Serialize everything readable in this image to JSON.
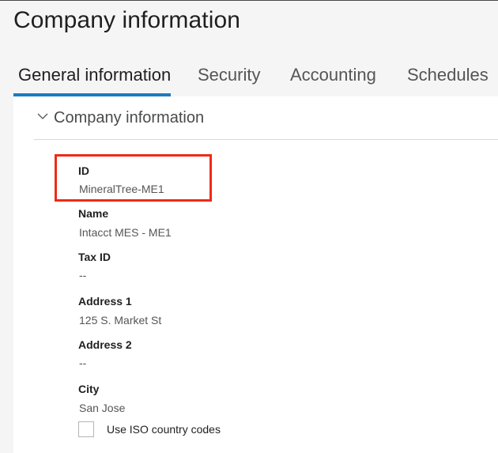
{
  "page": {
    "title": "Company information"
  },
  "tabs": [
    {
      "label": "General information",
      "active": true
    },
    {
      "label": "Security",
      "active": false
    },
    {
      "label": "Accounting",
      "active": false
    },
    {
      "label": "Schedules",
      "active": false
    }
  ],
  "section": {
    "title": "Company information",
    "expanded": true,
    "icon": "chevron-down-icon"
  },
  "fields": {
    "id": {
      "label": "ID",
      "value": "MineralTree-ME1"
    },
    "name": {
      "label": "Name",
      "value": "Intacct MES - ME1"
    },
    "tax_id": {
      "label": "Tax ID",
      "value": "--"
    },
    "address1": {
      "label": "Address 1",
      "value": "125 S. Market St"
    },
    "address2": {
      "label": "Address 2",
      "value": "--"
    },
    "city": {
      "label": "City",
      "value": "San Jose"
    }
  },
  "iso_checkbox": {
    "label": "Use ISO country codes",
    "checked": false
  },
  "colors": {
    "accent": "#1b7bbf",
    "highlight": "#ee2b18",
    "background": "#f5f5f5",
    "panel": "#ffffff"
  }
}
